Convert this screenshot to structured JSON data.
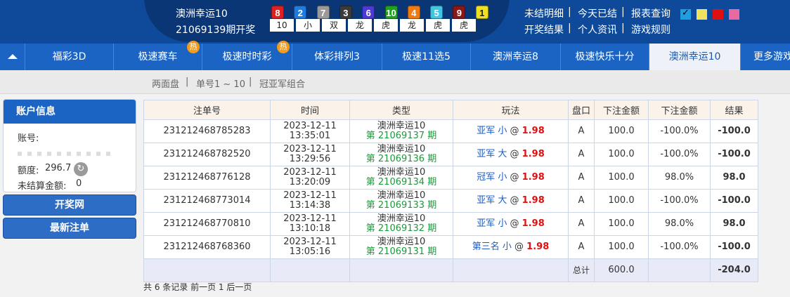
{
  "header": {
    "game_name": "澳洲幸运10",
    "issue_label": "21069139期开奖",
    "balls": [
      {
        "num": "8",
        "color": "#e02020"
      },
      {
        "num": "2",
        "color": "#1f7ce0"
      },
      {
        "num": "7",
        "color": "#9a9a9a"
      },
      {
        "num": "3",
        "color": "#3a3a3a"
      },
      {
        "num": "6",
        "color": "#4b3ad6"
      },
      {
        "num": "10",
        "color": "#1ea31e"
      },
      {
        "num": "4",
        "color": "#f07a10"
      },
      {
        "num": "5",
        "color": "#3ec6e6"
      },
      {
        "num": "9",
        "color": "#8a1818"
      },
      {
        "num": "1",
        "color": "#f0e020"
      }
    ],
    "stats": [
      "10",
      "小",
      "双",
      "龙",
      "虎",
      "龙",
      "虎",
      "虎"
    ],
    "links_row1": [
      "未结明细",
      "今天已结",
      "报表查询"
    ],
    "links_row2": [
      "开奖结果",
      "个人资讯",
      "游戏规则"
    ],
    "separator": "|",
    "theme_colors": [
      "#1f9de0",
      "#f0e060",
      "#e01010",
      "#e86aa0"
    ]
  },
  "nav": {
    "hot_badge": "热",
    "items": [
      "福彩3D",
      "极速赛车",
      "极速时时彩",
      "体彩排列3",
      "极速11选5",
      "澳洲幸运8",
      "极速快乐十分",
      "澳洲幸运10",
      "更多游戏"
    ]
  },
  "subnav": {
    "items": [
      "两面盘",
      "单号1 ~ 10",
      "冠亚军组合"
    ],
    "separator": "|"
  },
  "sidebar": {
    "account_title": "账户信息",
    "account_label": "账号:",
    "credit_label": "额度:",
    "credit_value": "296.7",
    "unsettled_label": "未结算金额:",
    "unsettled_value": "0",
    "btn_draw_site": "开奖网",
    "btn_latest_bets": "最新注单"
  },
  "table": {
    "headers": [
      "注单号",
      "时间",
      "类型",
      "玩法",
      "盘口",
      "下注金额",
      "下注金额",
      "结果"
    ],
    "rows": [
      {
        "id": "231212468785283",
        "date": "2023-12-11",
        "time": "13:35:01",
        "game": "澳洲幸运10",
        "period": "第 21069137 期",
        "play": "亚军 小",
        "at": "@",
        "odds": "1.98",
        "market": "A",
        "amount": "100.0",
        "rebate": "-100.0%",
        "result": "-100.0",
        "result_type": "neg"
      },
      {
        "id": "231212468782520",
        "date": "2023-12-11",
        "time": "13:29:56",
        "game": "澳洲幸运10",
        "period": "第 21069136 期",
        "play": "亚军 大",
        "at": "@",
        "odds": "1.98",
        "market": "A",
        "amount": "100.0",
        "rebate": "-100.0%",
        "result": "-100.0",
        "result_type": "neg"
      },
      {
        "id": "231212468776128",
        "date": "2023-12-11",
        "time": "13:20:09",
        "game": "澳洲幸运10",
        "period": "第 21069134 期",
        "play": "冠军 小",
        "at": "@",
        "odds": "1.98",
        "market": "A",
        "amount": "100.0",
        "rebate": "98.0%",
        "result": "98.0",
        "result_type": "pos"
      },
      {
        "id": "231212468773014",
        "date": "2023-12-11",
        "time": "13:14:38",
        "game": "澳洲幸运10",
        "period": "第 21069133 期",
        "play": "亚军 大",
        "at": "@",
        "odds": "1.98",
        "market": "A",
        "amount": "100.0",
        "rebate": "-100.0%",
        "result": "-100.0",
        "result_type": "neg"
      },
      {
        "id": "231212468770810",
        "date": "2023-12-11",
        "time": "13:10:18",
        "game": "澳洲幸运10",
        "period": "第 21069132 期",
        "play": "亚军 小",
        "at": "@",
        "odds": "1.98",
        "market": "A",
        "amount": "100.0",
        "rebate": "98.0%",
        "result": "98.0",
        "result_type": "pos"
      },
      {
        "id": "231212468768360",
        "date": "2023-12-11",
        "time": "13:05:16",
        "game": "澳洲幸运10",
        "period": "第 21069131 期",
        "play": "第三名 小",
        "at": "@",
        "odds": "1.98",
        "market": "A",
        "amount": "100.0",
        "rebate": "-100.0%",
        "result": "-100.0",
        "result_type": "neg"
      }
    ],
    "total_label": "总计",
    "total_amount": "600.0",
    "total_result": "-204.0"
  },
  "footer": {
    "pager": "共 6 条记录 前一页 1 后一页"
  }
}
